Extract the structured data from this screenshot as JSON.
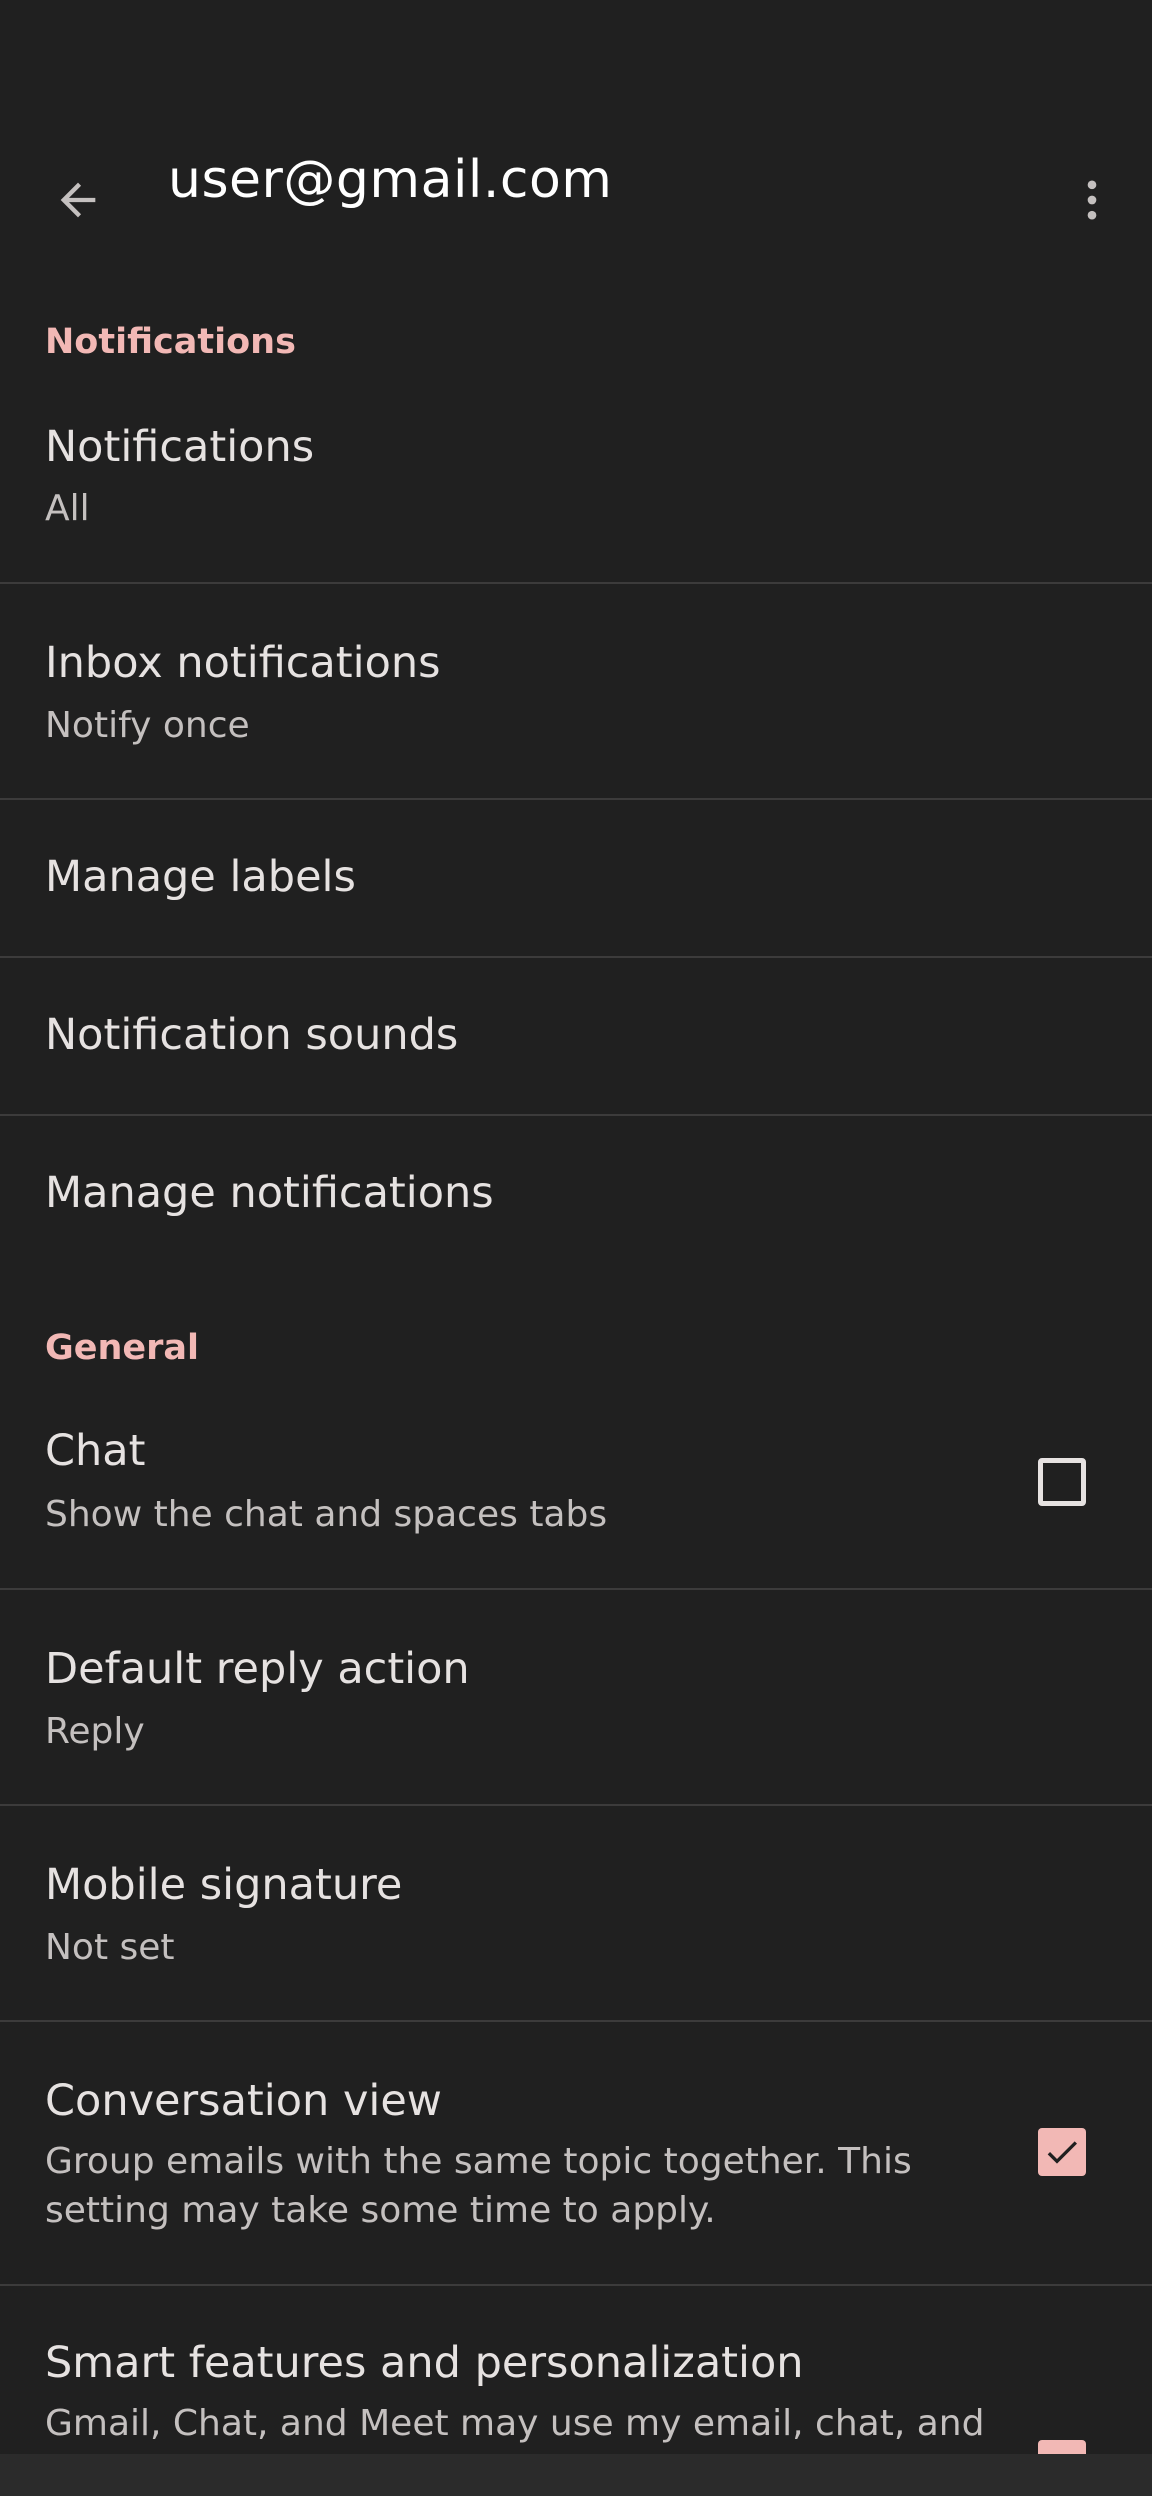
{
  "header": {
    "account_email": "user@gmail.com",
    "back_icon": "arrow-back-icon",
    "more_icon": "more-vert-icon"
  },
  "sections": {
    "notifications": "Notifications",
    "general": "General"
  },
  "items": {
    "notifications": {
      "title": "Notifications",
      "summary": "All"
    },
    "inbox_notifications": {
      "title": "Inbox notifications",
      "summary": "Notify once"
    },
    "manage_labels": {
      "title": "Manage labels"
    },
    "notification_sounds": {
      "title": "Notification sounds"
    },
    "manage_notifications": {
      "title": "Manage notifications"
    },
    "chat": {
      "title": "Chat",
      "summary": "Show the chat and spaces tabs",
      "checked": false
    },
    "default_reply_action": {
      "title": "Default reply action",
      "summary": "Reply"
    },
    "mobile_signature": {
      "title": "Mobile signature",
      "summary": "Not set"
    },
    "conversation_view": {
      "title": "Conversation view",
      "summary": "Group emails with the same topic together. This setting may take some time to apply.",
      "checked": true
    },
    "smart_features": {
      "title": "Smart features and personalization",
      "summary": "Gmail, Chat, and Meet may use my email, chat, and",
      "checked": true
    }
  },
  "colors": {
    "background": "#202020",
    "accent": "#f2b8b5",
    "primary_text": "#e6e2e1",
    "secondary_text": "#c4c0bf",
    "divider": "#3c3b3b"
  }
}
